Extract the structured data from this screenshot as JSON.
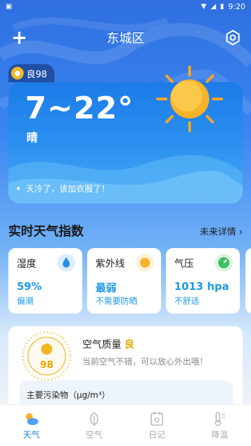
{
  "status_bar": {
    "time": "9:20"
  },
  "header": {
    "city": "东城区"
  },
  "weather": {
    "aqi_badge": "良98",
    "temperature_range": "7~22°",
    "condition": "晴",
    "notice": "天冷了，该加衣服了！"
  },
  "indices": {
    "title": "实时天气指数",
    "more_label": "未来详情",
    "cards": [
      {
        "name": "湿度",
        "value": "59%",
        "desc": "偏潮",
        "icon": "water-drop-icon"
      },
      {
        "name": "紫外线",
        "value": "最弱",
        "desc": "不需要防晒",
        "icon": "uv-sun-icon"
      },
      {
        "name": "气压",
        "value": "1013 hpa",
        "desc": "不舒适",
        "icon": "pressure-gauge-icon"
      }
    ]
  },
  "air_quality": {
    "aqi_value": "98",
    "title": "空气质量",
    "level": "良",
    "description": "当前空气不错，可以放心外出哦！",
    "pollutant_label": "主要污染物（μg/m³）"
  },
  "navbar": {
    "items": [
      {
        "label": "天气",
        "active": true
      },
      {
        "label": "空气",
        "active": false
      },
      {
        "label": "日记",
        "active": false
      },
      {
        "label": "降温",
        "active": false
      }
    ]
  },
  "colors": {
    "accent": "#1e82e8",
    "index_value": "#1e9be6",
    "aqi_gold": "#f2b824"
  }
}
